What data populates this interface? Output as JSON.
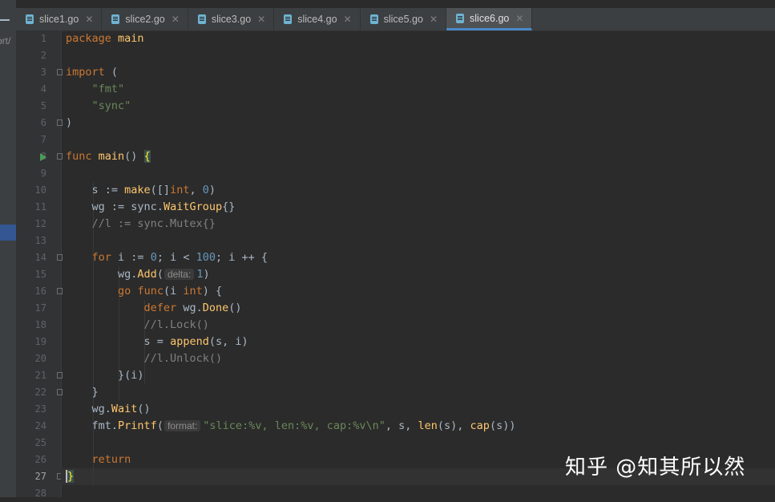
{
  "left_panel": {
    "path_fragment": "ort/"
  },
  "tabs": [
    {
      "label": "slice1.go",
      "active": false
    },
    {
      "label": "slice2.go",
      "active": false
    },
    {
      "label": "slice3.go",
      "active": false
    },
    {
      "label": "slice4.go",
      "active": false
    },
    {
      "label": "slice5.go",
      "active": false
    },
    {
      "label": "slice6.go",
      "active": true
    }
  ],
  "current_line": 27,
  "line_numbers": [
    "1",
    "2",
    "3",
    "4",
    "5",
    "6",
    "7",
    "8",
    "9",
    "10",
    "11",
    "12",
    "13",
    "14",
    "15",
    "16",
    "17",
    "18",
    "19",
    "20",
    "21",
    "22",
    "23",
    "24",
    "25",
    "26",
    "27",
    "28"
  ],
  "code": {
    "l1_kw": "package",
    "l1_name": "main",
    "l3_kw": "import",
    "l3_paren": "(",
    "l4_str": "\"fmt\"",
    "l5_str": "\"sync\"",
    "l6_paren": ")",
    "l8_kw": "func",
    "l8_fn": "main",
    "l8_rest": "() ",
    "l8_brace": "{",
    "l10_a": "s := ",
    "l10_fn": "make",
    "l10_b": "([]",
    "l10_kw": "int",
    "l10_c": ", ",
    "l10_num": "0",
    "l10_d": ")",
    "l11_a": "wg := ",
    "l11_pkg": "sync.",
    "l11_fn": "WaitGroup",
    "l11_b": "{}",
    "l12_cm": "//l := sync.Mutex{}",
    "l14_kw": "for",
    "l14_a": " i := ",
    "l14_num1": "0",
    "l14_b": "; i < ",
    "l14_num2": "100",
    "l14_c": "; i ++ {",
    "l15_a": "wg.",
    "l15_fn": "Add",
    "l15_b": "(",
    "l15_hint": "delta:",
    "l15_num": "1",
    "l15_c": ")",
    "l16_kw1": "go",
    "l16_kw2": "func",
    "l16_a": "(i ",
    "l16_kw3": "int",
    "l16_b": ") {",
    "l17_kw": "defer",
    "l17_a": " wg.",
    "l17_fn": "Done",
    "l17_b": "()",
    "l18_cm": "//l.Lock()",
    "l19_a": "s = ",
    "l19_fn": "append",
    "l19_b": "(s, i)",
    "l20_cm": "//l.Unlock()",
    "l21_a": "}(i)",
    "l22_a": "}",
    "l23_a": "wg.",
    "l23_fn": "Wait",
    "l23_b": "()",
    "l24_pkg": "fmt.",
    "l24_fn": "Printf",
    "l24_a": "(",
    "l24_hint": "format:",
    "l24_str": "\"slice:%v, len:%v, cap:%v\\n\"",
    "l24_b": ", s, ",
    "l24_fn2": "len",
    "l24_c": "(s), ",
    "l24_fn3": "cap",
    "l24_d": "(s))",
    "l26_kw": "return",
    "l27_brace": "}"
  },
  "watermark": "知乎 @知其所以然",
  "colors": {
    "background": "#2b2b2b",
    "keyword": "#cc7832",
    "function": "#ffc66d",
    "string": "#6a8759",
    "number": "#6897bb",
    "comment": "#808080",
    "active_tab_underline": "#4a88c7"
  }
}
